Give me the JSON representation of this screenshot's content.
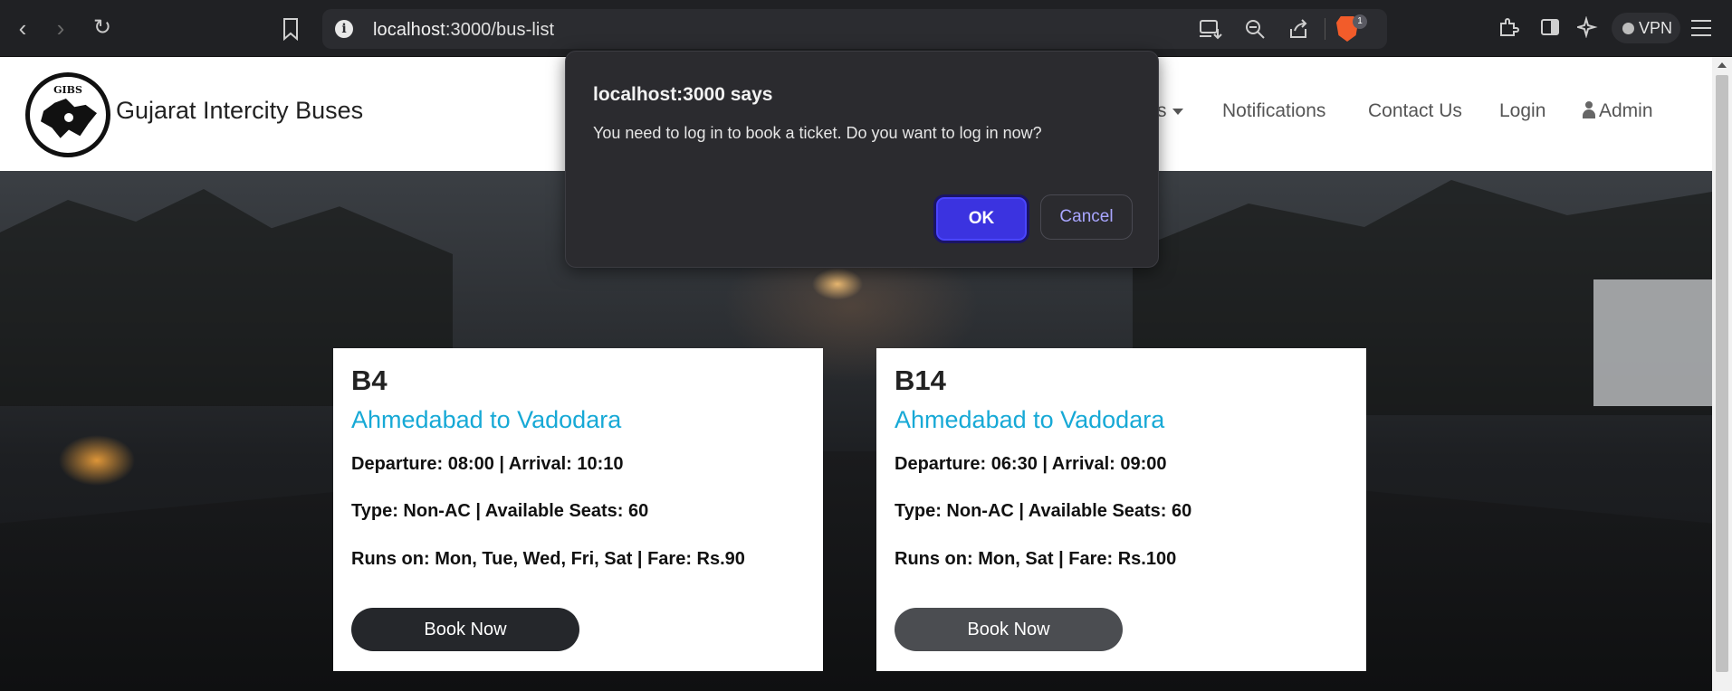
{
  "browser": {
    "url_host": "localhost",
    "url_path": ":3000/bus-list",
    "vpn_label": "VPN",
    "brave_badge_count": "1",
    "icons": [
      "back-icon",
      "forward-icon",
      "reload-icon",
      "bookmark-icon",
      "site-info-icon",
      "install-icon",
      "zoom-icon",
      "share-icon",
      "brave-shield-icon",
      "extensions-icon",
      "sidebar-icon",
      "leo-ai-icon",
      "menu-icon"
    ]
  },
  "navbar": {
    "brand": "Gujarat Intercity Buses",
    "logo_text": "GIBS",
    "items": [
      {
        "label": "s",
        "has_caret": true
      },
      {
        "label": "Notifications"
      },
      {
        "label": "Contact Us"
      },
      {
        "label": "Login"
      },
      {
        "label": "Admin"
      }
    ]
  },
  "buses": [
    {
      "bus_no": "B4",
      "route": "Ahmedabad to Vadodara",
      "timing": "Departure: 08:00 | Arrival: 10:10",
      "type_seats": "Type: Non-AC | Available Seats: 60",
      "runs_fare": "Runs on: Mon, Tue, Wed, Fri, Sat | Fare: Rs.90",
      "button": "Book Now"
    },
    {
      "bus_no": "B14",
      "route": "Ahmedabad to Vadodara",
      "timing": "Departure: 06:30 | Arrival: 09:00",
      "type_seats": "Type: Non-AC | Available Seats: 60",
      "runs_fare": "Runs on: Mon, Sat | Fare: Rs.100",
      "button": "Book Now"
    }
  ],
  "dialog": {
    "title": "localhost:3000 says",
    "message": "You need to log in to book a ticket. Do you want to log in now?",
    "ok_label": "OK",
    "cancel_label": "Cancel"
  },
  "colors": {
    "route_accent": "#17a9d6",
    "ok_button": "#3b33e0",
    "book_button": "#25272b"
  }
}
